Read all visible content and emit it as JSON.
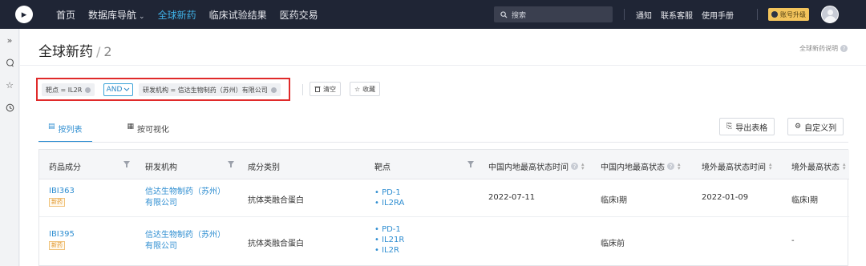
{
  "logo": {
    "glyph": "▸"
  },
  "nav": {
    "items": [
      {
        "label": "首页",
        "active": false
      },
      {
        "label": "数据库导航",
        "active": false,
        "caret": "⌄"
      },
      {
        "label": "全球新药",
        "active": true
      },
      {
        "label": "临床试验结果",
        "active": false
      },
      {
        "label": "医药交易",
        "active": false
      }
    ],
    "search_placeholder": "搜索",
    "right_items": [
      "通知",
      "联系客服",
      "使用手册"
    ],
    "upgrade_label": "账号升级"
  },
  "page": {
    "title": "全球新药",
    "count": "2",
    "help_link": "全球新药说明",
    "help_icon": "?"
  },
  "filters": {
    "chip1": "靶点 = IL2R",
    "operator": "AND",
    "chip2": "研发机构 = 信达生物制药（苏州）有限公司",
    "clear_label": "清空",
    "save_label": "收藏"
  },
  "tabs": [
    {
      "label": "按列表",
      "icon": "list-icon",
      "active": true
    },
    {
      "label": "按可视化",
      "icon": "grid-icon",
      "active": false
    }
  ],
  "actions": {
    "export_label": "导出表格",
    "customize_label": "自定义列"
  },
  "table": {
    "columns": [
      "药品成分",
      "研发机构",
      "成分类别",
      "靶点",
      "中国内地最高状态时间",
      "中国内地最高状态",
      "境外最高状态时间",
      "境外最高状态"
    ],
    "rows": [
      {
        "drug": "IBI363",
        "tag": "新药",
        "org_line1": "信达生物制药（苏州）",
        "org_line2": "有限公司",
        "category": "抗体类融合蛋白",
        "targets": [
          "PD-1",
          "IL2RA"
        ],
        "cn_date": "2022-07-11",
        "cn_status": "临床I期",
        "ov_date": "2022-01-09",
        "ov_status": "临床I期"
      },
      {
        "drug": "IBI395",
        "tag": "新药",
        "org_line1": "信达生物制药（苏州）",
        "org_line2": "有限公司",
        "category": "抗体类融合蛋白",
        "targets": [
          "PD-1",
          "IL21R",
          "IL2R"
        ],
        "cn_date": "",
        "cn_status": "临床前",
        "ov_date": "-",
        "ov_status": ""
      }
    ]
  },
  "colors": {
    "topbar": "#1f2535",
    "accent": "#2f8ed1",
    "highlight_border": "#e02a2a"
  }
}
